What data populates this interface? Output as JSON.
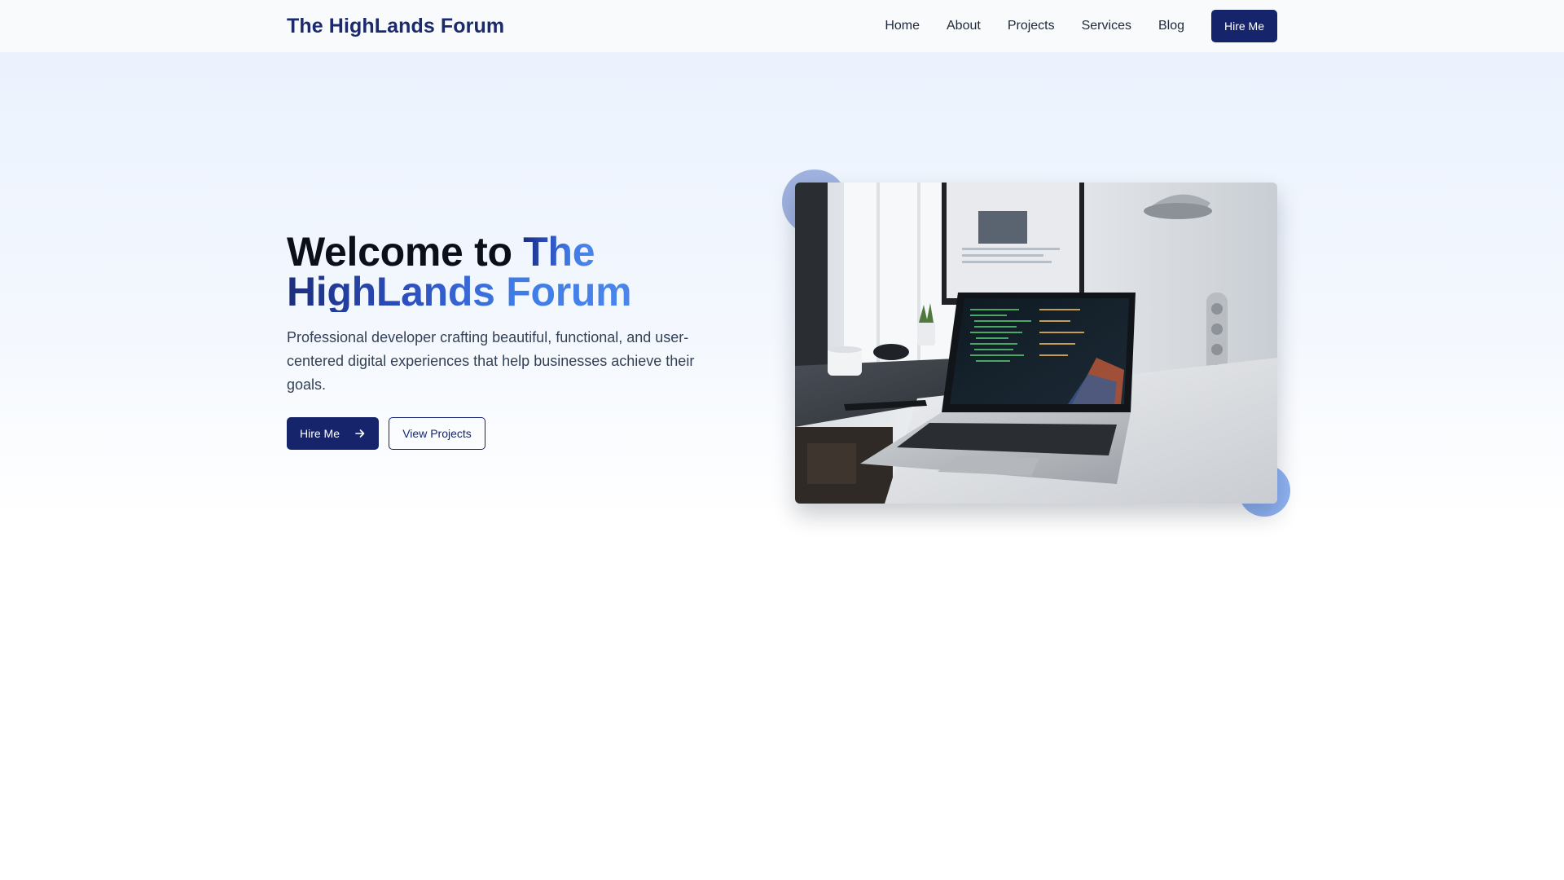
{
  "header": {
    "logo": "The HighLands Forum",
    "nav": [
      {
        "label": "Home"
      },
      {
        "label": "About"
      },
      {
        "label": "Projects"
      },
      {
        "label": "Services"
      },
      {
        "label": "Blog"
      }
    ],
    "cta_label": "Hire Me"
  },
  "hero": {
    "title_prefix": "Welcome to ",
    "title_accent_1": "The",
    "title_accent_2": "HighLands Forum",
    "description": "Professional developer crafting beautiful, functional, and user-centered digital experiences that help businesses achieve their goals.",
    "primary_button": {
      "label": "Hire Me",
      "icon": "arrow-right-icon"
    },
    "secondary_button": {
      "label": "View Projects"
    },
    "image": "laptop-on-desk-photo"
  },
  "colors": {
    "brand": "#16256b",
    "accent_gradient_start": "#1b2e7e",
    "accent_gradient_end": "#4a86ea",
    "hero_bg": "#ebf2fd"
  }
}
